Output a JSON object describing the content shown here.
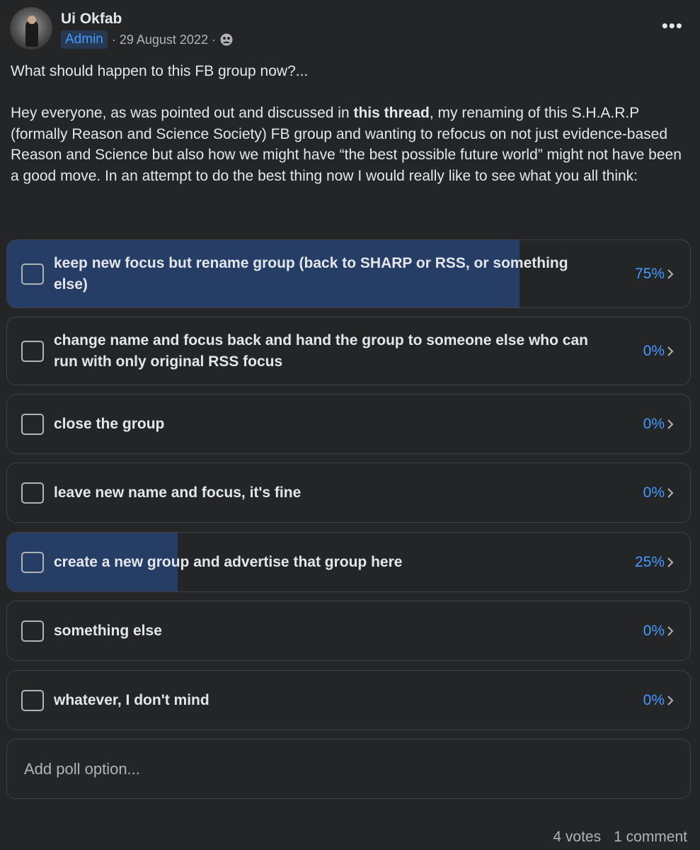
{
  "post": {
    "author": "Ui Okfab",
    "badge": "Admin",
    "date": "· 29 August 2022 ·",
    "privacy_icon": "group-icon",
    "more_label": "•••",
    "title": "What should happen to this FB group now?...",
    "body_before_link": "Hey everyone, as was pointed out and discussed in ",
    "link_text": "this thread",
    "body_after_link": ", my renaming of this S.H.A.R.P (formally Reason and Science Society) FB group and wanting to refocus on not just evidence-based Reason and Science but also how we might have “the best possible future world” might not have been a good move. In an attempt to do the best thing now I would really like to see what you all think:"
  },
  "poll": {
    "accent_color": "#4599ff",
    "fill_color": "#263e65",
    "options": [
      {
        "label": "keep new focus but rename group (back to SHARP or RSS, or something else)",
        "percent": "75%",
        "share": 0.75
      },
      {
        "label": "change name and focus back and hand the group to someone else who can run with only original RSS focus",
        "percent": "0%",
        "share": 0
      },
      {
        "label": "close the group",
        "percent": "0%",
        "share": 0
      },
      {
        "label": "leave new name and focus, it's fine",
        "percent": "0%",
        "share": 0
      },
      {
        "label": "create a new group and advertise that group here",
        "percent": "25%",
        "share": 0.25
      },
      {
        "label": "something else",
        "percent": "0%",
        "share": 0
      },
      {
        "label": "whatever, I don't mind",
        "percent": "0%",
        "share": 0
      }
    ],
    "add_placeholder": "Add poll option..."
  },
  "footer": {
    "votes": "4 votes",
    "comments": "1 comment"
  }
}
